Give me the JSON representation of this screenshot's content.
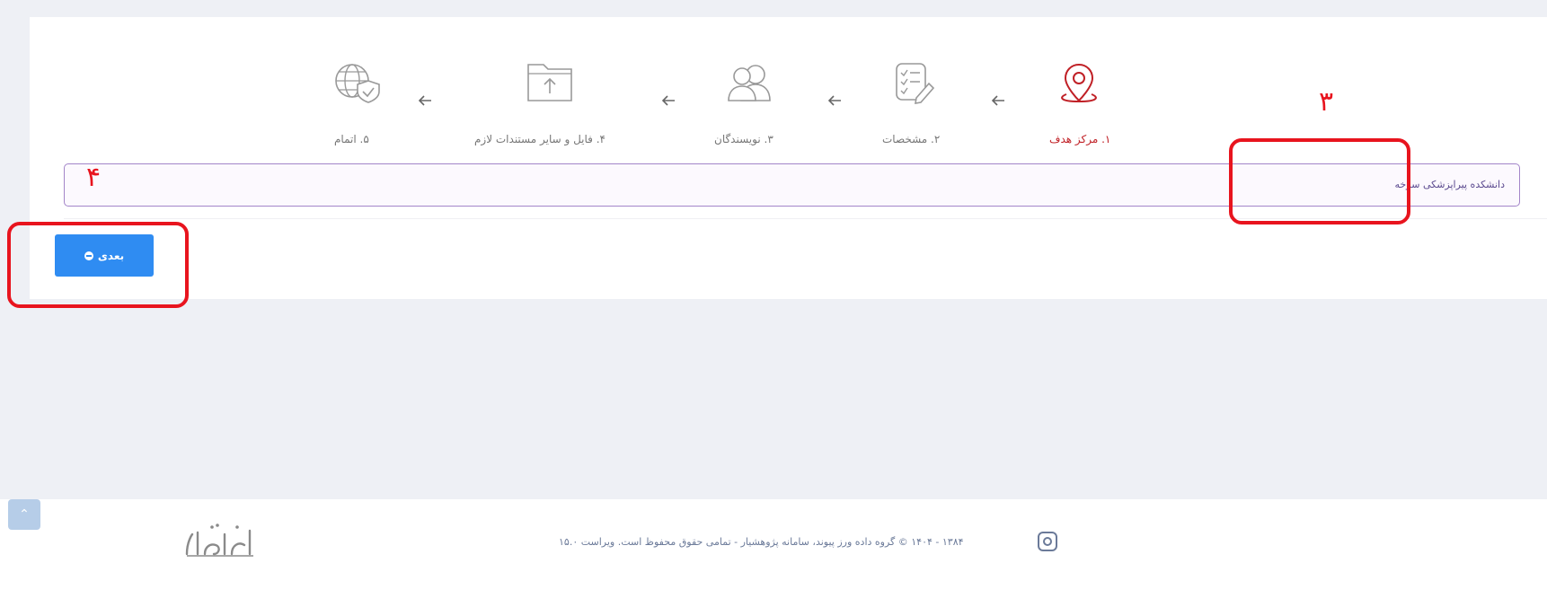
{
  "steps": [
    {
      "label": "۱. مرکز هدف",
      "icon": "map-pin-icon",
      "active": true
    },
    {
      "label": "۲. مشخصات",
      "icon": "checklist-edit-icon",
      "active": false
    },
    {
      "label": "۳. نویسندگان",
      "icon": "authors-icon",
      "active": false
    },
    {
      "label": "۴. فایل و سایر مستندات لازم",
      "icon": "folder-upload-icon",
      "active": false
    },
    {
      "label": "۵. اتمام",
      "icon": "globe-shield-icon",
      "active": false
    }
  ],
  "target_center": {
    "value": "دانشکده پیراپزشکی سرخه"
  },
  "next_button": {
    "label": "بعدی",
    "icon": "arrow-circle-icon"
  },
  "annotations": {
    "label_3": "۳",
    "label_4": "۴"
  },
  "footer": {
    "copyright": "۱۳۸۴ - ۱۴۰۴ © گروه داده ورز پیوند، سامانه پژوهشیار - تمامی حقوق محفوظ است. ویراست ۱۵.۰",
    "instagram_icon": "instagram-icon",
    "logo_text": "پژوهشیار",
    "scroll_top_icon": "chevron-up-icon"
  },
  "colors": {
    "accent": "#2f8cf2",
    "active_step": "#c02026",
    "annotation": "#e8141e",
    "target_border": "#a385c9"
  }
}
